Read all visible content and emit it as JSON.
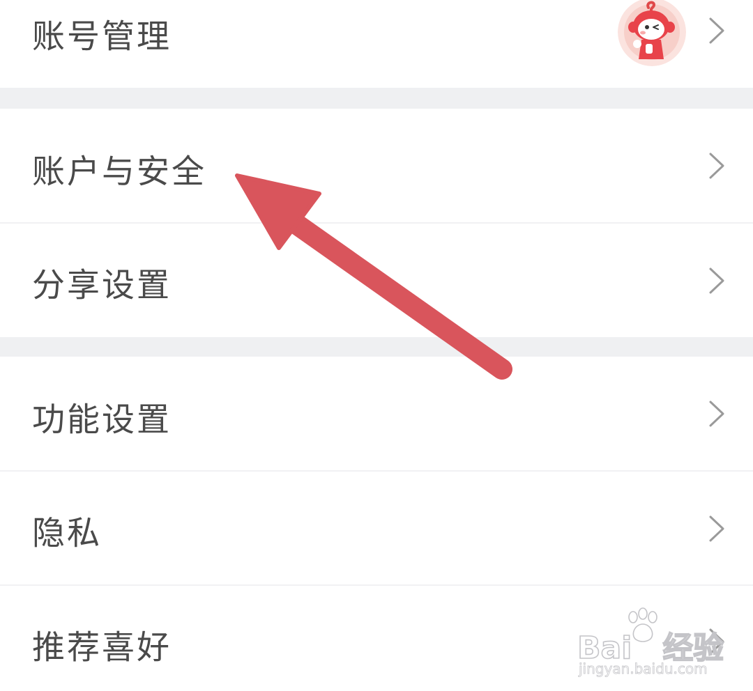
{
  "settings": {
    "items": [
      {
        "label": "账号管理",
        "has_avatar": true
      },
      {
        "label": "账户与安全"
      },
      {
        "label": "分享设置"
      },
      {
        "label": "功能设置"
      },
      {
        "label": "隐私"
      },
      {
        "label": "推荐喜好"
      }
    ],
    "chevron_icon": "chevron-right-icon",
    "avatar_icon": "cartoon-monkey-avatar",
    "text_color": "#4a4a4a",
    "chevron_color": "#9a9a9a",
    "section_gap_color": "#eff0f2"
  },
  "annotation": {
    "type": "arrow",
    "color": "#d9555c",
    "points_to": "账户与安全"
  },
  "watermark": {
    "brand_prefix": "Bai",
    "brand_suffix": "经验",
    "url": "jingyan.baidu.com"
  }
}
